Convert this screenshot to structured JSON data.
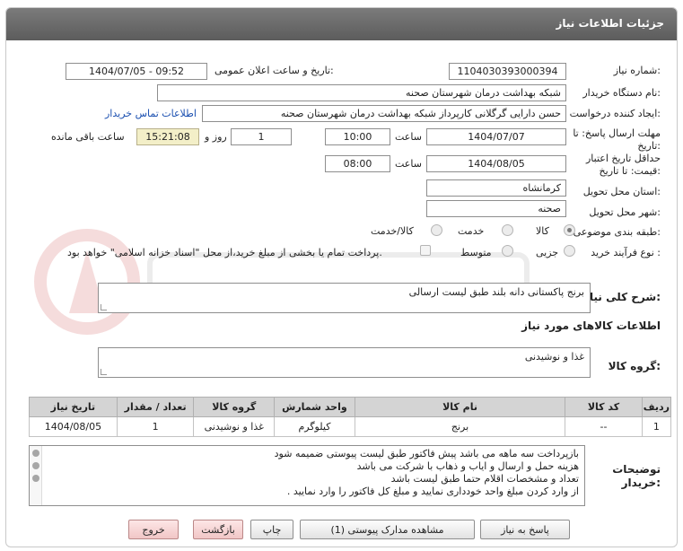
{
  "header": {
    "title": "جزئیات اطلاعات نیاز"
  },
  "form": {
    "need_number_label": "شماره نیاز:",
    "need_number": "1104030393000394",
    "announce_label": "تاریخ و ساعت اعلان عمومی:",
    "announce_value": "1404/07/05 - 09:52",
    "buyer_org_label": "نام دستگاه خریدار:",
    "buyer_org": "شبکه بهداشت درمان شهرستان صحنه",
    "creator_label": "ایجاد کننده درخواست:",
    "creator": "حسن دارایی گرگلانی کارپرداز شبکه بهداشت درمان شهرستان صحنه",
    "contact_link": "اطلاعات تماس خریدار",
    "deadline_label_1": "مهلت ارسال پاسخ: تا",
    "deadline_label_2": "تاریخ:",
    "deadline_date": "1404/07/07",
    "time_label": "ساعت",
    "deadline_time": "10:00",
    "days_value": "1",
    "days_label": "روز و",
    "remaining_time": "15:21:08",
    "remaining_label": "ساعت باقی مانده",
    "validity_label_1": "حداقل تاریخ اعتبار",
    "validity_label_2": "قیمت: تا تاریخ:",
    "validity_date": "1404/08/05",
    "validity_time_label": "ساعت",
    "validity_time": "08:00",
    "province_label": "استان محل تحویل:",
    "province": "کرمانشاه",
    "city_label": "شهر محل تحویل:",
    "city": "صحنه",
    "category_label": "طبقه بندی موضوعی:",
    "category_options": [
      "کالا",
      "خدمت",
      "کالا/خدمت"
    ],
    "category_selected": "کالا",
    "process_label": "نوع فرآیند خرید :",
    "process_options": [
      "جزیی",
      "متوسط"
    ],
    "payment_note": "پرداخت تمام یا بخشی از مبلغ خرید،از محل \"اسناد خزانه اسلامی\" خواهد بود."
  },
  "description": {
    "label": "شرح کلی نیاز:",
    "value": "برنج پاکستانی دانه بلند طبق لیست ارسالی"
  },
  "goods": {
    "section_title": "اطلاعات کالاهای مورد نیاز",
    "group_label": "گروه کالا:",
    "group_value": "غذا و نوشیدنی"
  },
  "table": {
    "headers": [
      "ردیف",
      "کد کالا",
      "نام کالا",
      "واحد شمارش",
      "گروه کالا",
      "تعداد / مقدار",
      "تاریخ نیاز"
    ],
    "rows": [
      [
        "1",
        "--",
        "برنج",
        "کیلوگرم",
        "غذا و نوشیدنی",
        "1",
        "1404/08/05"
      ]
    ]
  },
  "notes": {
    "label_1": "توضیحات",
    "label_2": "خریدار:",
    "lines": [
      "بازپرداخت سه ماهه می باشد پیش فاکتور طبق لیست پیوستی ضمیمه شود",
      "هزینه حمل و ارسال و ایاب و ذهاب با شرکت می باشد",
      "تعداد و مشخصات اقلام حتما طبق لیست باشد",
      "از وارد کردن مبلغ واحد خودداری نمایید و مبلغ کل فاکتور را وارد نمایید ."
    ]
  },
  "buttons": {
    "reply": "پاسخ به نیاز",
    "attachments": "مشاهده مدارک پیوستی (1)",
    "print": "چاپ",
    "back": "بازگشت",
    "exit": "خروج"
  },
  "colors": {
    "header_bg": "#666666",
    "link": "#1a4fb0",
    "remaining_bg": "#f3efc8",
    "exit_bg": "#f4d0d0"
  }
}
